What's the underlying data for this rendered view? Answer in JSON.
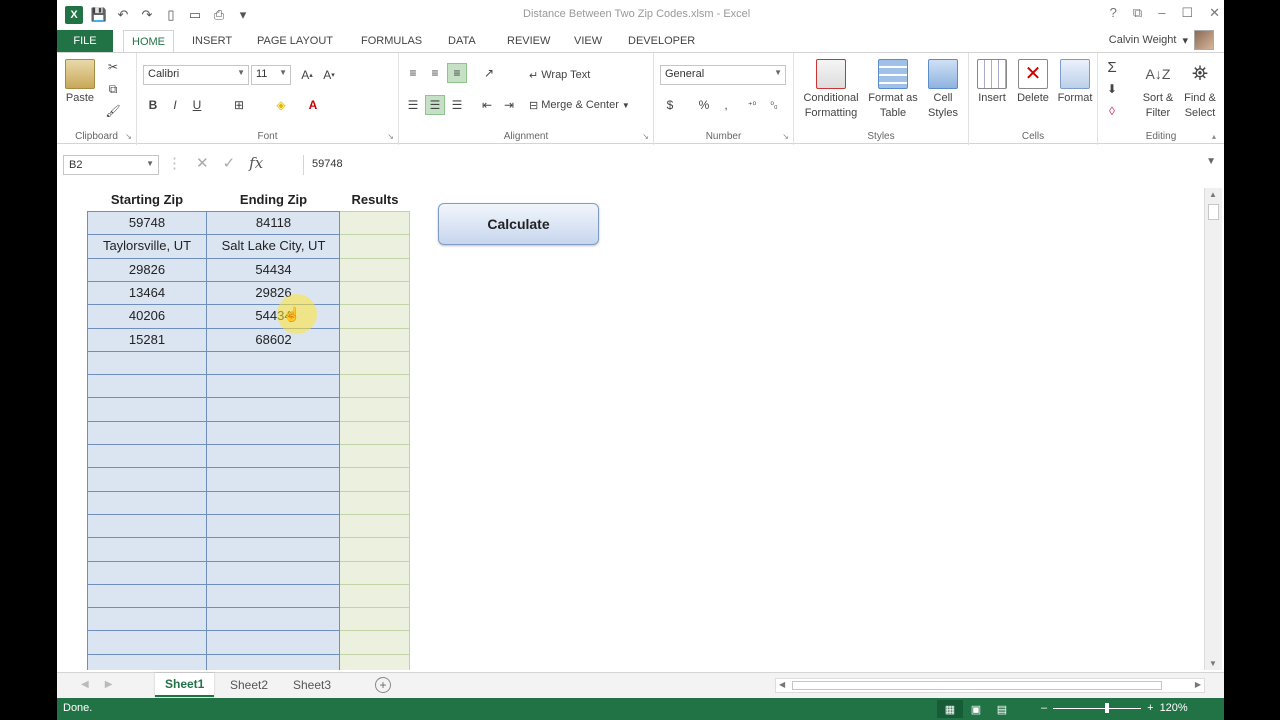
{
  "window": {
    "title": "Distance Between Two Zip Codes.xlsm - Excel",
    "user": "Calvin Weight"
  },
  "tabs": [
    "FILE",
    "HOME",
    "INSERT",
    "PAGE LAYOUT",
    "FORMULAS",
    "DATA",
    "REVIEW",
    "VIEW",
    "DEVELOPER"
  ],
  "ribbon": {
    "clipboard": {
      "paste": "Paste",
      "label": "Clipboard"
    },
    "font": {
      "name": "Calibri",
      "size": "11",
      "label": "Font",
      "bold": "B",
      "italic": "I",
      "underline": "U"
    },
    "alignment": {
      "wrap": "Wrap Text",
      "merge": "Merge & Center",
      "label": "Alignment"
    },
    "number": {
      "format": "General",
      "label": "Number",
      "currency": "$",
      "percent": "%",
      "comma": ","
    },
    "styles": {
      "conditional": "Conditional",
      "conditional2": "Formatting",
      "format_table": "Format as",
      "format_table2": "Table",
      "cell_styles": "Cell",
      "cell_styles2": "Styles",
      "label": "Styles"
    },
    "cells": {
      "insert": "Insert",
      "delete": "Delete",
      "format": "Format",
      "label": "Cells"
    },
    "editing": {
      "sort": "Sort &",
      "sort2": "Filter",
      "find": "Find &",
      "find2": "Select",
      "label": "Editing",
      "sigma": "Σ"
    }
  },
  "formula_bar": {
    "name_box": "B2",
    "value": "59748",
    "fx": "fx"
  },
  "sheet": {
    "headers": {
      "a": "Starting Zip",
      "b": "Ending Zip",
      "c": "Results"
    },
    "rows": [
      {
        "a": "59748",
        "b": "84118"
      },
      {
        "a": "Taylorsville, UT",
        "b": "Salt Lake City, UT"
      },
      {
        "a": "29826",
        "b": "54434"
      },
      {
        "a": "13464",
        "b": "29826"
      },
      {
        "a": "40206",
        "b": "54434"
      },
      {
        "a": "15281",
        "b": "68602"
      }
    ],
    "button": "Calculate"
  },
  "sheet_tabs": [
    "Sheet1",
    "Sheet2",
    "Sheet3"
  ],
  "status": {
    "text": "Done.",
    "zoom": "120%"
  },
  "colors": {
    "accent": "#217346",
    "blue_fill": "#dbe5f1",
    "green_fill": "#ebf1de"
  }
}
